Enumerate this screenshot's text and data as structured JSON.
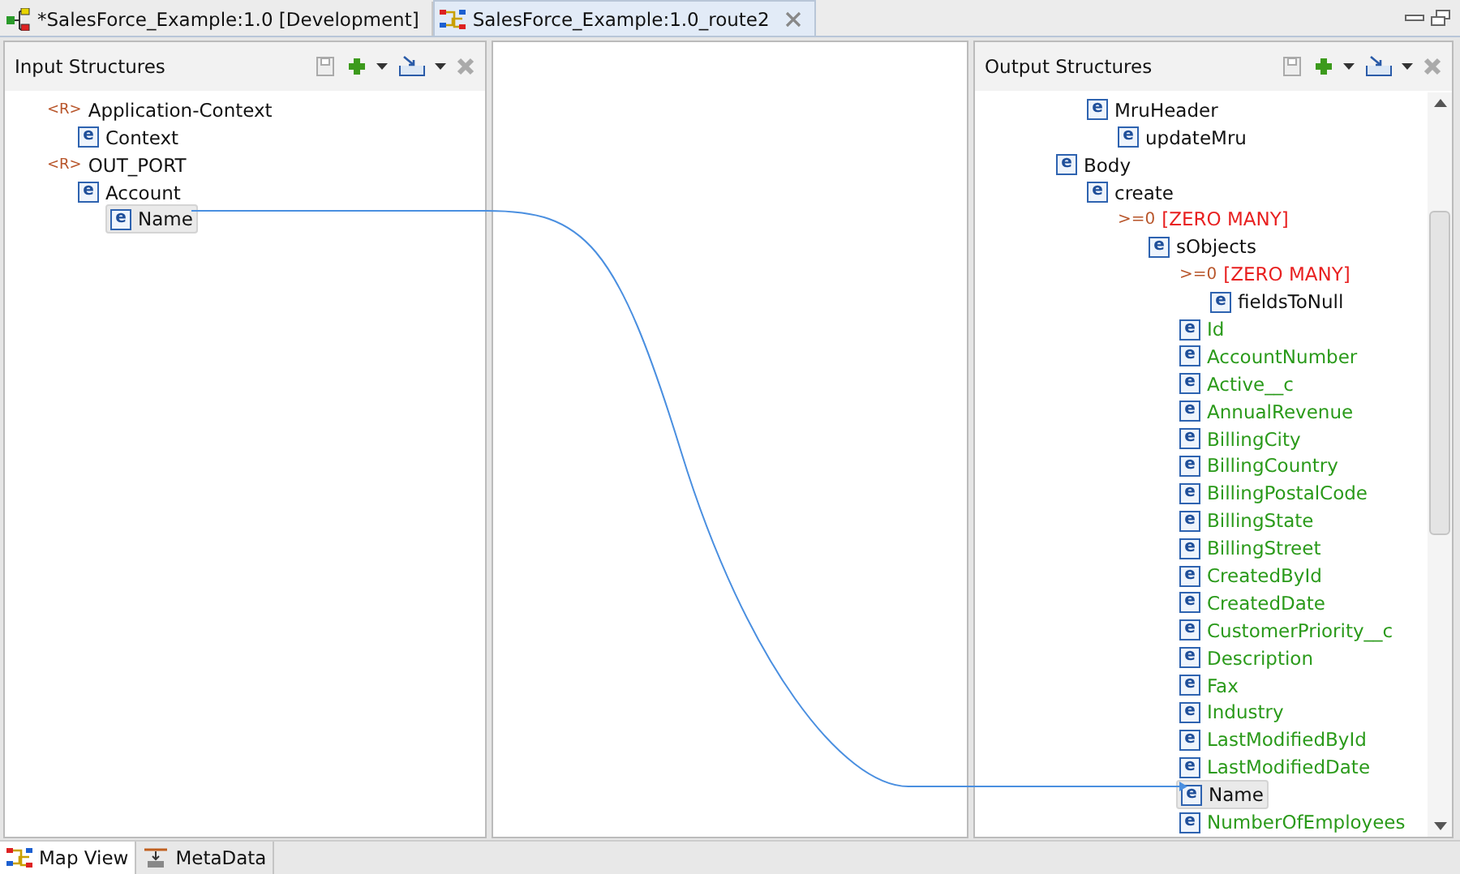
{
  "editor_tabs": [
    {
      "label": "*SalesForce_Example:1.0 [Development]",
      "kind": "project",
      "selected": false
    },
    {
      "label": "SalesForce_Example:1.0_route2",
      "kind": "map",
      "selected": true
    }
  ],
  "input": {
    "title": "Input Structures",
    "tree": [
      {
        "symbol": "<R>",
        "label": "Application-Context",
        "kind": "root",
        "selected": false,
        "children": [
          {
            "symbol": "e",
            "label": "Context",
            "kind": "element",
            "selected": false
          }
        ]
      },
      {
        "symbol": "<R>",
        "label": "OUT_PORT",
        "kind": "root",
        "selected": false,
        "children": [
          {
            "symbol": "e",
            "label": "Account",
            "kind": "element",
            "selected": false,
            "children": [
              {
                "symbol": "e",
                "label": "Name",
                "kind": "element",
                "selected": true
              }
            ]
          }
        ]
      }
    ]
  },
  "output": {
    "title": "Output Structures",
    "tree": [
      {
        "children": [
          {
            "symbol": "e",
            "label": "MruHeader",
            "kind": "element",
            "selected": false,
            "children": [
              {
                "symbol": "e",
                "label": "updateMru",
                "kind": "element",
                "selected": false
              }
            ]
          }
        ]
      },
      {
        "symbol": "e",
        "label": "Body",
        "kind": "element",
        "selected": false,
        "children": [
          {
            "symbol": "e",
            "label": "create",
            "kind": "element",
            "selected": false,
            "children": [
              {
                "symbol": ">=0",
                "label": "[ZERO MANY]",
                "kind": "cardinality",
                "selected": false,
                "children": [
                  {
                    "symbol": "e",
                    "label": "sObjects",
                    "kind": "element",
                    "selected": false,
                    "children": [
                      {
                        "symbol": ">=0",
                        "label": "[ZERO MANY]",
                        "kind": "cardinality",
                        "selected": false,
                        "children": [
                          {
                            "symbol": "e",
                            "label": "fieldsToNull",
                            "kind": "element",
                            "selected": false
                          }
                        ]
                      },
                      {
                        "symbol": "e",
                        "label": "Id",
                        "kind": "field",
                        "selected": false
                      },
                      {
                        "symbol": "e",
                        "label": "AccountNumber",
                        "kind": "field",
                        "selected": false
                      },
                      {
                        "symbol": "e",
                        "label": "Active__c",
                        "kind": "field",
                        "selected": false
                      },
                      {
                        "symbol": "e",
                        "label": "AnnualRevenue",
                        "kind": "field",
                        "selected": false
                      },
                      {
                        "symbol": "e",
                        "label": "BillingCity",
                        "kind": "field",
                        "selected": false
                      },
                      {
                        "symbol": "e",
                        "label": "BillingCountry",
                        "kind": "field",
                        "selected": false
                      },
                      {
                        "symbol": "e",
                        "label": "BillingPostalCode",
                        "kind": "field",
                        "selected": false
                      },
                      {
                        "symbol": "e",
                        "label": "BillingState",
                        "kind": "field",
                        "selected": false
                      },
                      {
                        "symbol": "e",
                        "label": "BillingStreet",
                        "kind": "field",
                        "selected": false
                      },
                      {
                        "symbol": "e",
                        "label": "CreatedById",
                        "kind": "field",
                        "selected": false
                      },
                      {
                        "symbol": "e",
                        "label": "CreatedDate",
                        "kind": "field",
                        "selected": false
                      },
                      {
                        "symbol": "e",
                        "label": "CustomerPriority__c",
                        "kind": "field",
                        "selected": false
                      },
                      {
                        "symbol": "e",
                        "label": "Description",
                        "kind": "field",
                        "selected": false
                      },
                      {
                        "symbol": "e",
                        "label": "Fax",
                        "kind": "field",
                        "selected": false
                      },
                      {
                        "symbol": "e",
                        "label": "Industry",
                        "kind": "field",
                        "selected": false
                      },
                      {
                        "symbol": "e",
                        "label": "LastModifiedById",
                        "kind": "field",
                        "selected": false
                      },
                      {
                        "symbol": "e",
                        "label": "LastModifiedDate",
                        "kind": "field",
                        "selected": false
                      },
                      {
                        "symbol": "e",
                        "label": "Name",
                        "kind": "element",
                        "selected": true
                      },
                      {
                        "symbol": "e",
                        "label": "NumberOfEmployees",
                        "kind": "field",
                        "selected": false
                      }
                    ]
                  }
                ]
              }
            ]
          }
        ]
      }
    ]
  },
  "bottom_tabs": [
    {
      "label": "Map View",
      "kind": "map",
      "selected": true
    },
    {
      "label": "MetaData",
      "kind": "meta",
      "selected": false
    }
  ]
}
